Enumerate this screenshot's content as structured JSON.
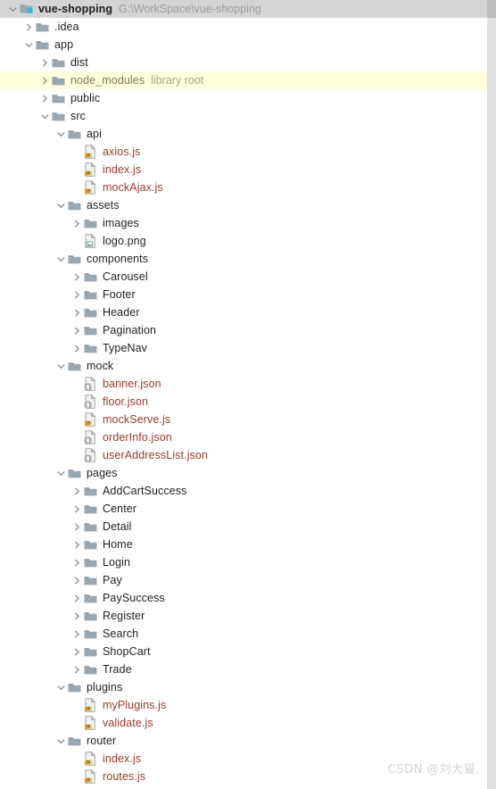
{
  "window": {
    "kind": "project-tree-panel",
    "background": "#ffffff",
    "selection_color": "#d4d4d4",
    "highlight_color": "#ffffdd",
    "js_text_color": "#9c3a2a",
    "folder_color": "#9aa7b0",
    "js_badge_color": "#f3c164"
  },
  "watermark": {
    "text": "CSDN @刘大猫."
  },
  "scrollbar": {
    "name": "vertical-scrollbar"
  },
  "tree": {
    "rows": [
      {
        "indent": 0,
        "twisty": "down",
        "icon": "module-folder-icon",
        "label": "vue-shopping",
        "bold": true,
        "suffix": "G:\\WorkSpace\\vue-shopping",
        "selected": true
      },
      {
        "indent": 1,
        "twisty": "right",
        "icon": "folder-icon",
        "label": ".idea"
      },
      {
        "indent": 1,
        "twisty": "down",
        "icon": "folder-icon",
        "label": "app"
      },
      {
        "indent": 2,
        "twisty": "right",
        "icon": "folder-icon",
        "label": "dist"
      },
      {
        "indent": 2,
        "twisty": "right",
        "icon": "folder-icon",
        "label": "node_modules",
        "suffix": "library root",
        "suffix_kind": "lib",
        "style": "excluded",
        "highlight": true
      },
      {
        "indent": 2,
        "twisty": "right",
        "icon": "folder-icon",
        "label": "public"
      },
      {
        "indent": 2,
        "twisty": "down",
        "icon": "folder-icon",
        "label": "src"
      },
      {
        "indent": 3,
        "twisty": "down",
        "icon": "folder-icon",
        "label": "api"
      },
      {
        "indent": 4,
        "twisty": "none",
        "icon": "js-file-icon",
        "label": "axios.js",
        "style": "js"
      },
      {
        "indent": 4,
        "twisty": "none",
        "icon": "js-file-icon",
        "label": "index.js",
        "style": "js"
      },
      {
        "indent": 4,
        "twisty": "none",
        "icon": "js-file-icon",
        "label": "mockAjax.js",
        "style": "js"
      },
      {
        "indent": 3,
        "twisty": "down",
        "icon": "folder-icon",
        "label": "assets"
      },
      {
        "indent": 4,
        "twisty": "right",
        "icon": "folder-icon",
        "label": "images"
      },
      {
        "indent": 4,
        "twisty": "none",
        "icon": "image-file-icon",
        "label": "logo.png"
      },
      {
        "indent": 3,
        "twisty": "down",
        "icon": "folder-icon",
        "label": "components"
      },
      {
        "indent": 4,
        "twisty": "right",
        "icon": "folder-icon",
        "label": "Carousel"
      },
      {
        "indent": 4,
        "twisty": "right",
        "icon": "folder-icon",
        "label": "Footer"
      },
      {
        "indent": 4,
        "twisty": "right",
        "icon": "folder-icon",
        "label": "Header"
      },
      {
        "indent": 4,
        "twisty": "right",
        "icon": "folder-icon",
        "label": "Pagination"
      },
      {
        "indent": 4,
        "twisty": "right",
        "icon": "folder-icon",
        "label": "TypeNav"
      },
      {
        "indent": 3,
        "twisty": "down",
        "icon": "folder-icon",
        "label": "mock"
      },
      {
        "indent": 4,
        "twisty": "none",
        "icon": "json-file-icon",
        "label": "banner.json",
        "style": "json"
      },
      {
        "indent": 4,
        "twisty": "none",
        "icon": "json-file-icon",
        "label": "floor.json",
        "style": "json"
      },
      {
        "indent": 4,
        "twisty": "none",
        "icon": "js-file-icon",
        "label": "mockServe.js",
        "style": "js"
      },
      {
        "indent": 4,
        "twisty": "none",
        "icon": "json-file-icon",
        "label": "orderInfo.json",
        "style": "json"
      },
      {
        "indent": 4,
        "twisty": "none",
        "icon": "json-file-icon",
        "label": "userAddressList.json",
        "style": "json"
      },
      {
        "indent": 3,
        "twisty": "down",
        "icon": "folder-icon",
        "label": "pages"
      },
      {
        "indent": 4,
        "twisty": "right",
        "icon": "folder-icon",
        "label": "AddCartSuccess"
      },
      {
        "indent": 4,
        "twisty": "right",
        "icon": "folder-icon",
        "label": "Center"
      },
      {
        "indent": 4,
        "twisty": "right",
        "icon": "folder-icon",
        "label": "Detail"
      },
      {
        "indent": 4,
        "twisty": "right",
        "icon": "folder-icon",
        "label": "Home"
      },
      {
        "indent": 4,
        "twisty": "right",
        "icon": "folder-icon",
        "label": "Login"
      },
      {
        "indent": 4,
        "twisty": "right",
        "icon": "folder-icon",
        "label": "Pay"
      },
      {
        "indent": 4,
        "twisty": "right",
        "icon": "folder-icon",
        "label": "PaySuccess"
      },
      {
        "indent": 4,
        "twisty": "right",
        "icon": "folder-icon",
        "label": "Register"
      },
      {
        "indent": 4,
        "twisty": "right",
        "icon": "folder-icon",
        "label": "Search"
      },
      {
        "indent": 4,
        "twisty": "right",
        "icon": "folder-icon",
        "label": "ShopCart"
      },
      {
        "indent": 4,
        "twisty": "right",
        "icon": "folder-icon",
        "label": "Trade"
      },
      {
        "indent": 3,
        "twisty": "down",
        "icon": "folder-icon",
        "label": "plugins"
      },
      {
        "indent": 4,
        "twisty": "none",
        "icon": "js-file-icon",
        "label": "myPlugins.js",
        "style": "js"
      },
      {
        "indent": 4,
        "twisty": "none",
        "icon": "js-file-icon",
        "label": "validate.js",
        "style": "js"
      },
      {
        "indent": 3,
        "twisty": "down",
        "icon": "folder-icon",
        "label": "router"
      },
      {
        "indent": 4,
        "twisty": "none",
        "icon": "js-file-icon",
        "label": "index.js",
        "style": "js"
      },
      {
        "indent": 4,
        "twisty": "none",
        "icon": "js-file-icon",
        "label": "routes.js",
        "style": "js"
      }
    ]
  }
}
